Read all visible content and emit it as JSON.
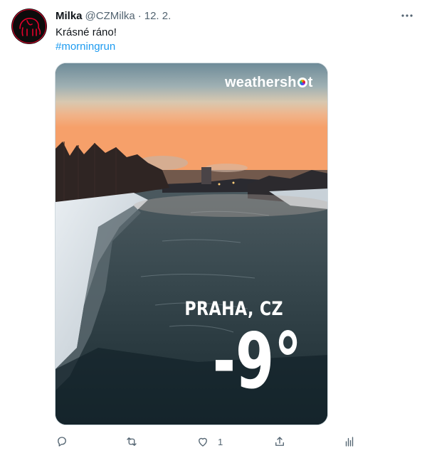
{
  "tweet": {
    "author_name": "Milka",
    "handle": "@CZMilka",
    "separator": "·",
    "date": "12. 2.",
    "text": "Krásné ráno!",
    "hashtag": "#morningrun"
  },
  "media": {
    "logo_text_before": "weathersh",
    "logo_text_after": "t",
    "city": "PRAHA, CZ",
    "temperature": "-9°"
  },
  "actions": {
    "reply_icon": "reply-icon",
    "retweet_icon": "retweet-icon",
    "like_icon": "heart-icon",
    "like_count": "1",
    "share_icon": "share-icon",
    "analytics_icon": "analytics-icon"
  },
  "colors": {
    "link": "#1d9bf0",
    "secondary_text": "#536471",
    "avatar_bg": "#0c0c0c",
    "avatar_accent": "#e4002b"
  }
}
